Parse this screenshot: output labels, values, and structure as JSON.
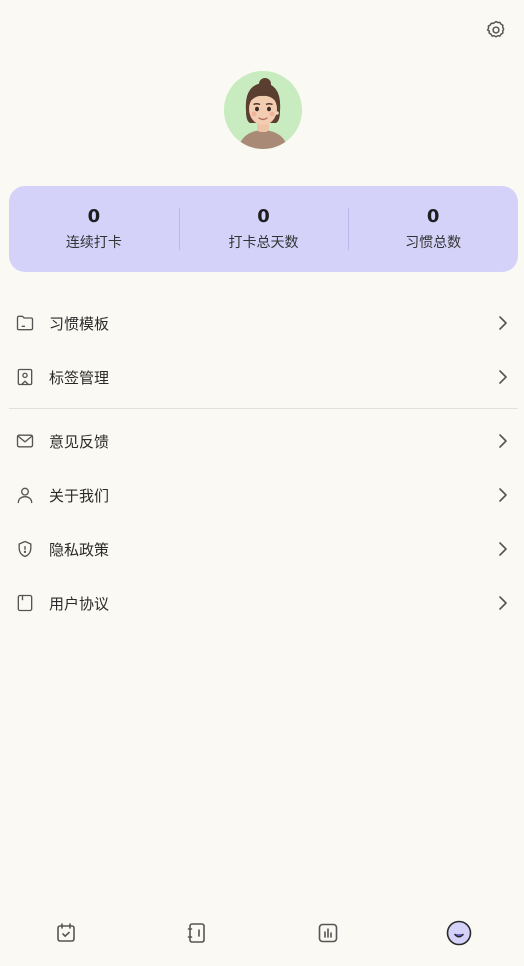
{
  "header": {
    "settings_icon": "gear-icon"
  },
  "profile": {
    "avatar_icon": "avatar-3d-character"
  },
  "stats": [
    {
      "value": "0",
      "label": "连续打卡"
    },
    {
      "value": "0",
      "label": "打卡总天数"
    },
    {
      "value": "0",
      "label": "习惯总数"
    }
  ],
  "menu_group_1": [
    {
      "label": "习惯模板",
      "icon": "folder-icon"
    },
    {
      "label": "标签管理",
      "icon": "tag-icon"
    }
  ],
  "menu_group_2": [
    {
      "label": "意见反馈",
      "icon": "mail-icon"
    },
    {
      "label": "关于我们",
      "icon": "user-icon"
    },
    {
      "label": "隐私政策",
      "icon": "shield-icon"
    },
    {
      "label": "用户协议",
      "icon": "document-icon"
    }
  ],
  "tabbar": [
    {
      "icon": "calendar-check-icon",
      "active": false
    },
    {
      "icon": "notebook-icon",
      "active": false
    },
    {
      "icon": "bar-chart-icon",
      "active": false
    },
    {
      "icon": "profile-face-icon",
      "active": true
    }
  ],
  "colors": {
    "background": "#fbf9f3",
    "card": "#d5d2fa",
    "accent": "#6f63d9",
    "text": "#2a2a2a",
    "icon": "#555555"
  }
}
